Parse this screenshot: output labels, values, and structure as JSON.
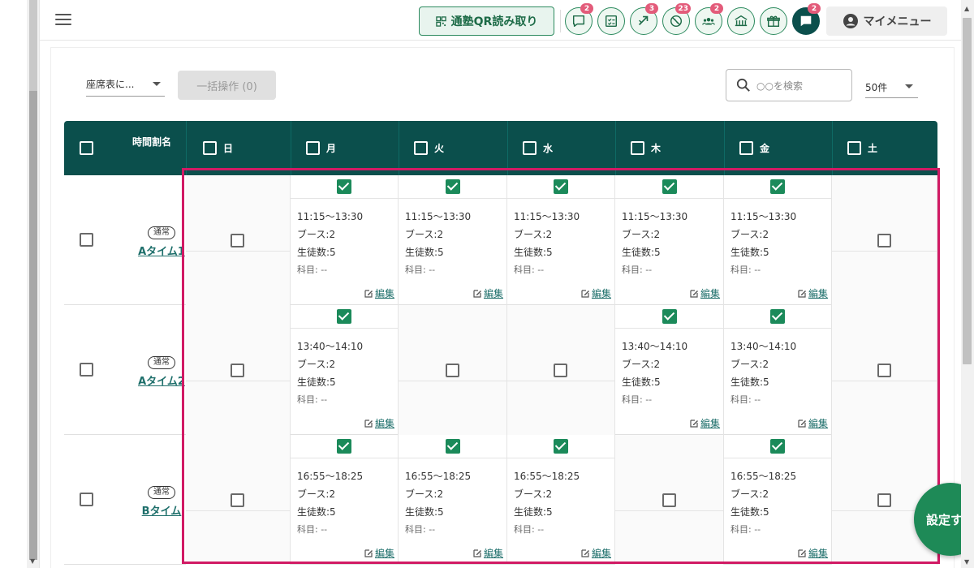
{
  "header": {
    "qr_label": "通塾QR読み取り",
    "icons": [
      {
        "name": "chat-icon",
        "badge": "2"
      },
      {
        "name": "checklist-icon",
        "badge": ""
      },
      {
        "name": "transfer-icon",
        "badge": "3"
      },
      {
        "name": "no-entry-icon",
        "badge": "23"
      },
      {
        "name": "group-icon",
        "badge": "2"
      },
      {
        "name": "school-icon",
        "badge": ""
      },
      {
        "name": "gift-icon",
        "badge": ""
      },
      {
        "name": "message-icon",
        "badge": "2"
      }
    ],
    "mymenu_label": "マイメニュー"
  },
  "toolbar": {
    "seat_select": "座席表に...",
    "bulk_label": "一括操作 (0)",
    "search_placeholder": "○○を検索",
    "per_page": "50件"
  },
  "table": {
    "time_col": "時間割名",
    "days": [
      "日",
      "月",
      "火",
      "水",
      "木",
      "金",
      "土"
    ],
    "rows": [
      {
        "tag": "通常",
        "name": "Aタイム1",
        "cells": [
          null,
          {
            "time": "11:15〜13:30",
            "booth": "ブース:2",
            "students": "生徒数:5",
            "subject": "科目: --",
            "edit": "編集"
          },
          {
            "time": "11:15〜13:30",
            "booth": "ブース:2",
            "students": "生徒数:5",
            "subject": "科目: --",
            "edit": "編集"
          },
          {
            "time": "11:15〜13:30",
            "booth": "ブース:2",
            "students": "生徒数:5",
            "subject": "科目: --",
            "edit": "編集"
          },
          {
            "time": "11:15〜13:30",
            "booth": "ブース:2",
            "students": "生徒数:5",
            "subject": "科目: --",
            "edit": "編集"
          },
          {
            "time": "11:15〜13:30",
            "booth": "ブース:2",
            "students": "生徒数:5",
            "subject": "科目: --",
            "edit": "編集"
          },
          null
        ]
      },
      {
        "tag": "通常",
        "name": "Aタイム2",
        "cells": [
          null,
          {
            "time": "13:40〜14:10",
            "booth": "ブース:2",
            "students": "生徒数:5",
            "subject": "科目: --",
            "edit": "編集"
          },
          null,
          null,
          {
            "time": "13:40〜14:10",
            "booth": "ブース:2",
            "students": "生徒数:5",
            "subject": "科目: --",
            "edit": "編集"
          },
          {
            "time": "13:40〜14:10",
            "booth": "ブース:2",
            "students": "生徒数:5",
            "subject": "科目: --",
            "edit": "編集"
          },
          null
        ]
      },
      {
        "tag": "通常",
        "name": "Bタイム",
        "cells": [
          null,
          {
            "time": "16:55〜18:25",
            "booth": "ブース:2",
            "students": "生徒数:5",
            "subject": "科目: --",
            "edit": "編集"
          },
          {
            "time": "16:55〜18:25",
            "booth": "ブース:2",
            "students": "生徒数:5",
            "subject": "科目: --",
            "edit": "編集"
          },
          {
            "time": "16:55〜18:25",
            "booth": "ブース:2",
            "students": "生徒数:5",
            "subject": "科目: --",
            "edit": "編集"
          },
          null,
          {
            "time": "16:55〜18:25",
            "booth": "ブース:2",
            "students": "生徒数:5",
            "subject": "科目: --",
            "edit": "編集"
          },
          null
        ]
      }
    ]
  },
  "fab_label": "設定する",
  "colors": {
    "header_bg": "#0b4f4c",
    "accent_green": "#1b8a5a",
    "badge": "#e35b7a",
    "highlight": "#d11a64",
    "link": "#1e6f6b"
  }
}
